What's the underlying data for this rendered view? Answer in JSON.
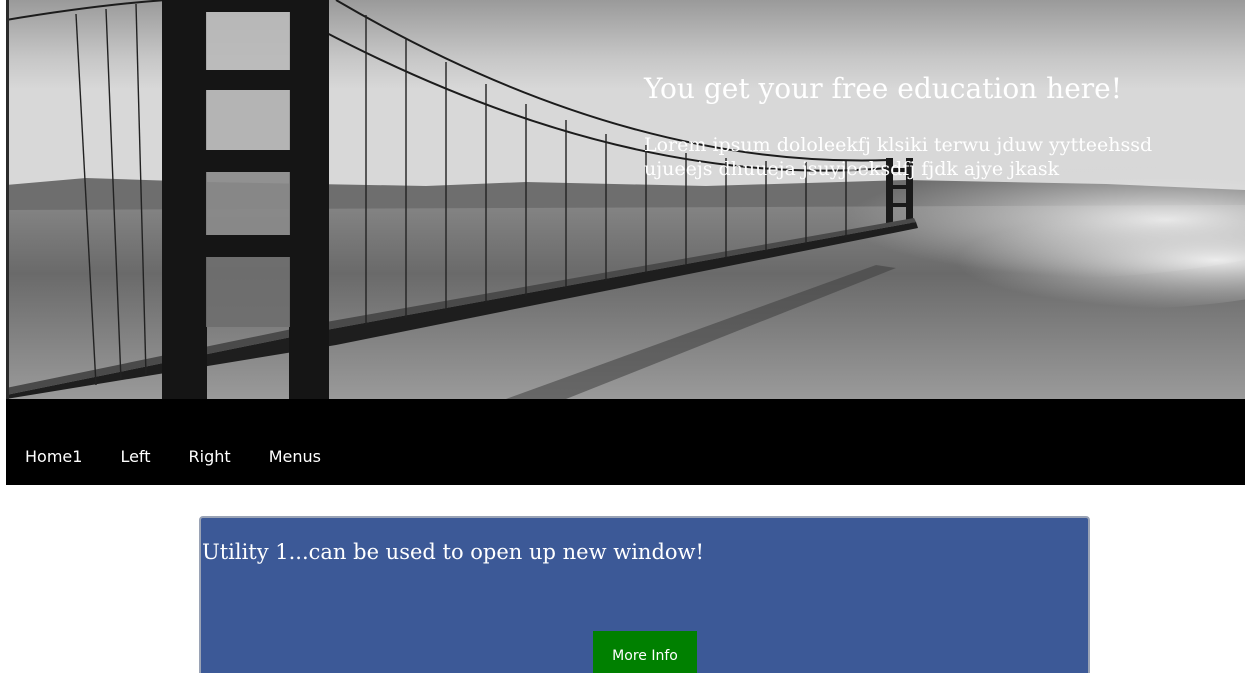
{
  "hero": {
    "title": "You get your free education here!",
    "text": "Lorem ipsum dololeekfj klsiki terwu jduw yytteehssd ujueejs dhuueja jsuyjeeksdfj fjdk ajye jkask",
    "image": "golden-gate-bridge-photo"
  },
  "nav": {
    "items": [
      {
        "label": "Home1"
      },
      {
        "label": "Left"
      },
      {
        "label": "Right"
      },
      {
        "label": "Menus"
      }
    ]
  },
  "utility": {
    "title": "Utility 1...can be used to open up new window!",
    "button_label": "More Info"
  },
  "colors": {
    "nav_background": "#000000",
    "card_background": "#3c5997",
    "button_background": "#008000",
    "text_light": "#ffffff"
  }
}
